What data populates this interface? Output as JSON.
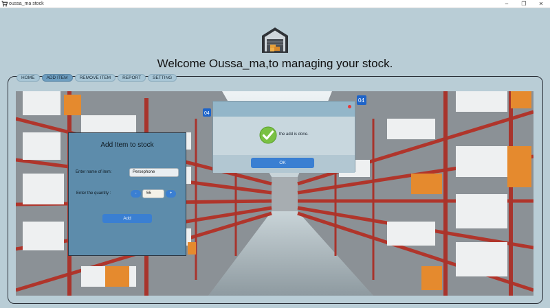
{
  "window": {
    "title": "oussa_ma stock",
    "minimize": "–",
    "restore": "❐",
    "close": "✕"
  },
  "header": {
    "welcome": "Welcome Oussa_ma,to managing your stock.",
    "logo_icon": "warehouse-icon"
  },
  "tabs": [
    {
      "label": "HOME"
    },
    {
      "label": "ADD ITEM",
      "active": true
    },
    {
      "label": "REMOVE ITEM"
    },
    {
      "label": "REPORT"
    },
    {
      "label": "SETTING"
    }
  ],
  "add_item": {
    "title": "Add Item to stock",
    "name_label": "Enter name of item:",
    "name_value": "Persephone",
    "quantity_label": "Enter the quantity :",
    "quantity_value": "55",
    "minus_label": "-",
    "plus_label": "+",
    "add_button": "Add"
  },
  "dialog": {
    "message": "the add is done.",
    "ok_button": "OK",
    "icon": "check-icon"
  },
  "colors": {
    "background": "#b9cdd6",
    "accent_blue": "#3a7fd2",
    "panel": "#5d8cab",
    "success_green": "#7ac143"
  }
}
